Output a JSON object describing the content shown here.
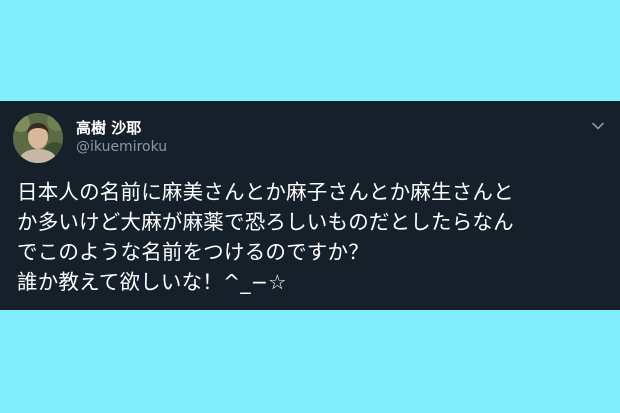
{
  "tweet": {
    "display_name": "高樹 沙耶",
    "handle": "@ikuemiroku",
    "lines": [
      "日本人の名前に麻美さんとか麻子さんとか麻生さんと",
      "か多いけど大麻が麻薬で恐ろしいものだとしたらなん",
      "でこのような名前をつけるのですか？",
      "誰か教えて欲しいな！^_−☆"
    ]
  },
  "colors": {
    "page_background": "#82eefb",
    "card_background": "#15202b",
    "text_primary": "#ffffff",
    "text_secondary": "#8899a6"
  },
  "icons": {
    "menu": "chevron-down-icon",
    "avatar": "avatar"
  }
}
